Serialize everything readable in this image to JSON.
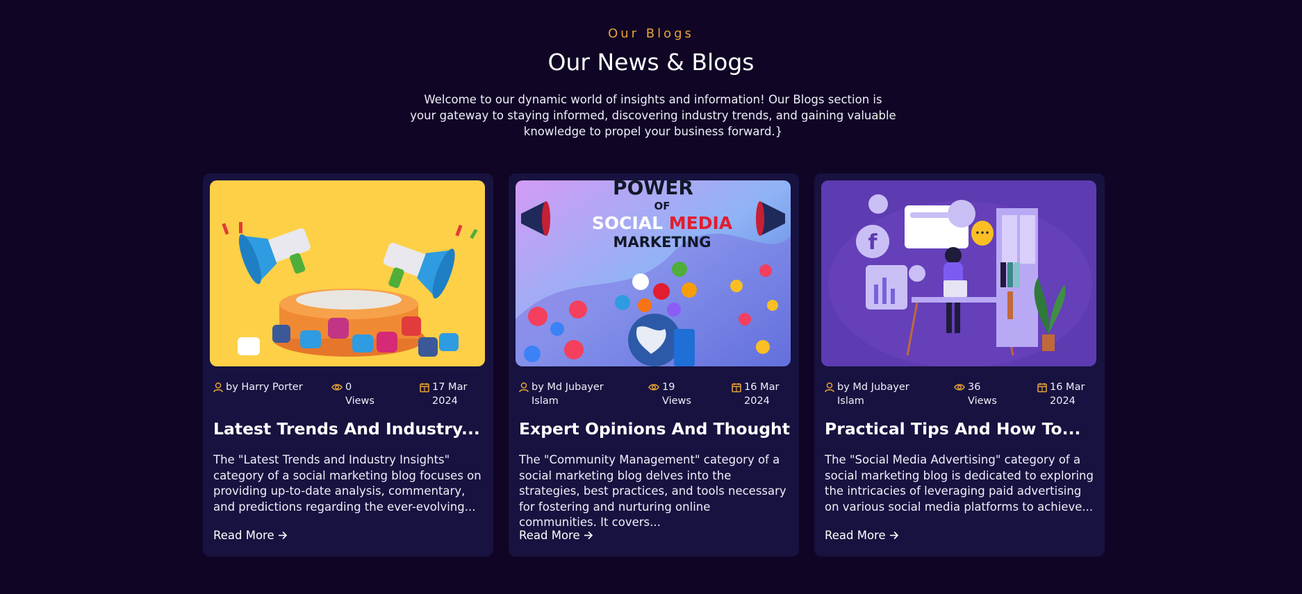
{
  "section": {
    "eyebrow": "Our Blogs",
    "title": "Our News & Blogs",
    "intro": "Welcome to our dynamic world of insights and information! Our Blogs section is your gateway to staying informed, discovering industry trends, and gaining valuable knowledge to propel your business forward.}"
  },
  "colors": {
    "background": "#100525",
    "card": "#17123f",
    "accent": "#e8a435"
  },
  "icons": {
    "author": "user-icon",
    "views": "eye-icon",
    "date": "calendar-icon",
    "read_more": "arrow-right-icon"
  },
  "cards": [
    {
      "image": "megaphones-social-icons-illustration",
      "author": "by Harry Porter",
      "views": "0 Views",
      "date": "17 Mar 2024",
      "title": "Latest Trends And Industry...",
      "excerpt": "The \"Latest Trends and Industry Insights\" category of a social marketing blog focuses on providing up-to-date analysis, commentary, and predictions regarding the ever-evolving...",
      "read_more": "Read More"
    },
    {
      "image": "power-of-social-media-marketing-illustration",
      "image_text": {
        "line1": "POWER",
        "line2": "OF",
        "line3a": "SOCIAL ",
        "line3b": "MEDIA",
        "line4": "MARKETING"
      },
      "author": "by Md Jubayer Islam",
      "views": "19 Views",
      "date": "16 Mar 2024",
      "title": "Expert Opinions And Thought...",
      "excerpt": "The \"Community Management\" category of a social marketing blog delves into the strategies, best practices, and tools necessary for fostering and nurturing online communities. It covers...",
      "read_more": "Read More"
    },
    {
      "image": "woman-at-desk-social-icons-illustration",
      "author": "by Md Jubayer Islam",
      "views": "36 Views",
      "date": "16 Mar 2024",
      "title": "Practical Tips And How To...",
      "excerpt": "The \"Social Media Advertising\" category of a social marketing blog is dedicated to exploring the intricacies of leveraging paid advertising on various social media platforms to achieve...",
      "read_more": "Read More"
    }
  ]
}
